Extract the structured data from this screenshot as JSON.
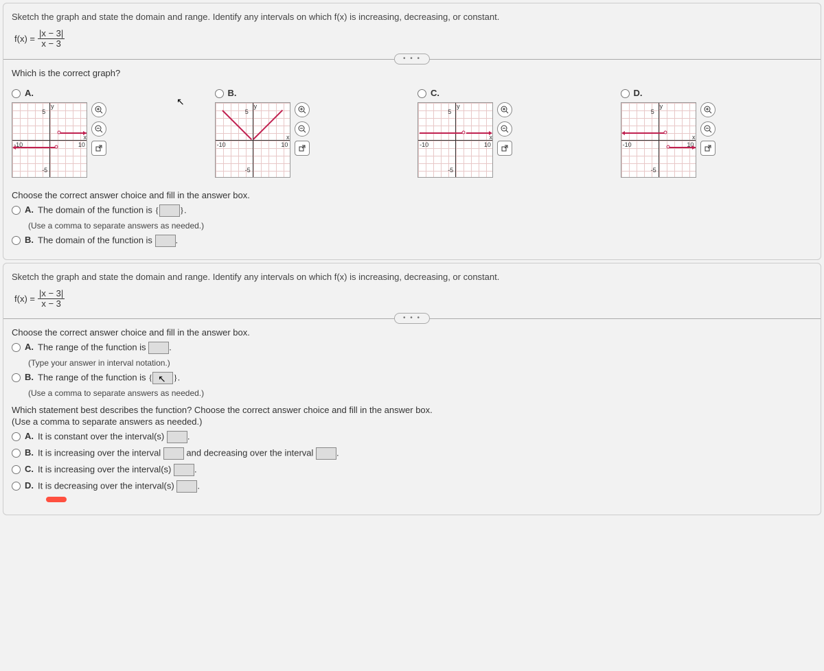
{
  "q": {
    "prompt": "Sketch the graph and state the domain and range. Identify any intervals on which f(x) is increasing, decreasing, or constant.",
    "fx_label": "f(x) =",
    "frac_num": "|x − 3|",
    "frac_den": "x − 3"
  },
  "graph_q": {
    "prompt": "Which is the correct graph?",
    "options": [
      "A.",
      "B.",
      "C.",
      "D."
    ],
    "axis_y": "y",
    "axis_x": "x",
    "tick_neg10": "-10",
    "tick_pos10": "10",
    "tick_5": "5",
    "tick_neg5": "-5"
  },
  "domain_q": {
    "prompt": "Choose the correct answer choice and fill in the answer box.",
    "optA_pre": "The domain of the function is ",
    "optA_post": ".",
    "optA_hint": "(Use a comma to separate answers as needed.)",
    "optB": "The domain of the function is ",
    "optB_post": "."
  },
  "range_q": {
    "prompt": "Choose the correct answer choice and fill in the answer box.",
    "optA_pre": "The range of the function is ",
    "optA_post": ".",
    "optA_hint": "(Type your answer in interval notation.)",
    "optB_pre": "The range of the function is ",
    "optB_post": ".",
    "optB_hint": "(Use a comma to separate answers as needed.)"
  },
  "behavior_q": {
    "prompt": "Which statement best describes the function?  Choose the correct answer choice and fill in the answer box.",
    "hint": "(Use a comma to separate answers as needed.)",
    "optA_pre": "It is constant over the interval(s) ",
    "optA_post": ".",
    "optB_pre": "It is increasing over the interval ",
    "optB_mid": " and decreasing over the interval ",
    "optB_post": ".",
    "optC_pre": "It is increasing over the interval(s) ",
    "optC_post": ".",
    "optD_pre": "It is decreasing over the interval(s) ",
    "optD_post": "."
  },
  "labels": {
    "A": "A.",
    "B": "B.",
    "C": "C.",
    "D": "D."
  },
  "icons": {
    "zoom_in": "⊕",
    "zoom_out": "⊖",
    "popout": "↗"
  },
  "ellipsis": "• • •"
}
